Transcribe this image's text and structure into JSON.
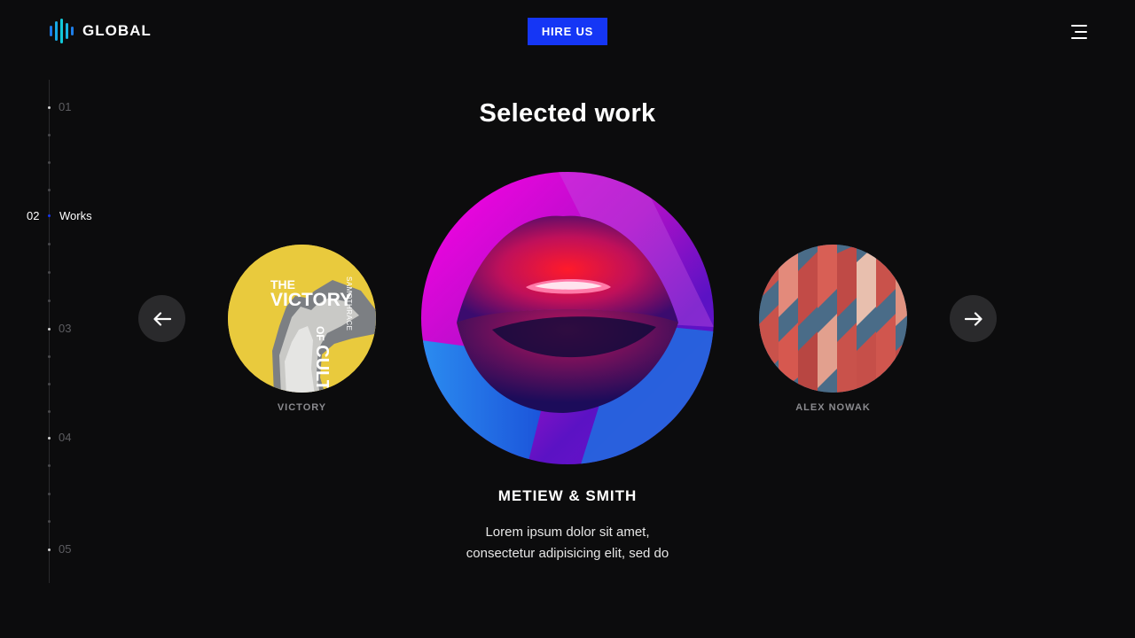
{
  "header": {
    "brand": "GLOBAL",
    "hire_label": "HIRE US",
    "menu_icon": "hamburger-icon",
    "accent": "#1536f5"
  },
  "sidenav": {
    "items": [
      {
        "number": "01",
        "label": ""
      },
      {
        "number": "02",
        "label": "Works"
      },
      {
        "number": "03",
        "label": ""
      },
      {
        "number": "04",
        "label": ""
      },
      {
        "number": "05",
        "label": ""
      }
    ],
    "active_index": 1
  },
  "section": {
    "title": "Selected work"
  },
  "carousel": {
    "prev_icon": "arrow-left-icon",
    "next_icon": "arrow-right-icon",
    "works": [
      {
        "caption": "VICTORY",
        "poster": {
          "line1": "THE",
          "line2": "VICTORY",
          "line3": "OF",
          "line4": "CULTURE",
          "side": "SAMOTHRACE"
        }
      },
      {
        "caption": "METIEW & SMITH",
        "description_line1": "Lorem ipsum dolor sit amet,",
        "description_line2": "consectetur adipisicing elit, sed do"
      },
      {
        "caption": "ALEX NOWAK"
      }
    ]
  }
}
